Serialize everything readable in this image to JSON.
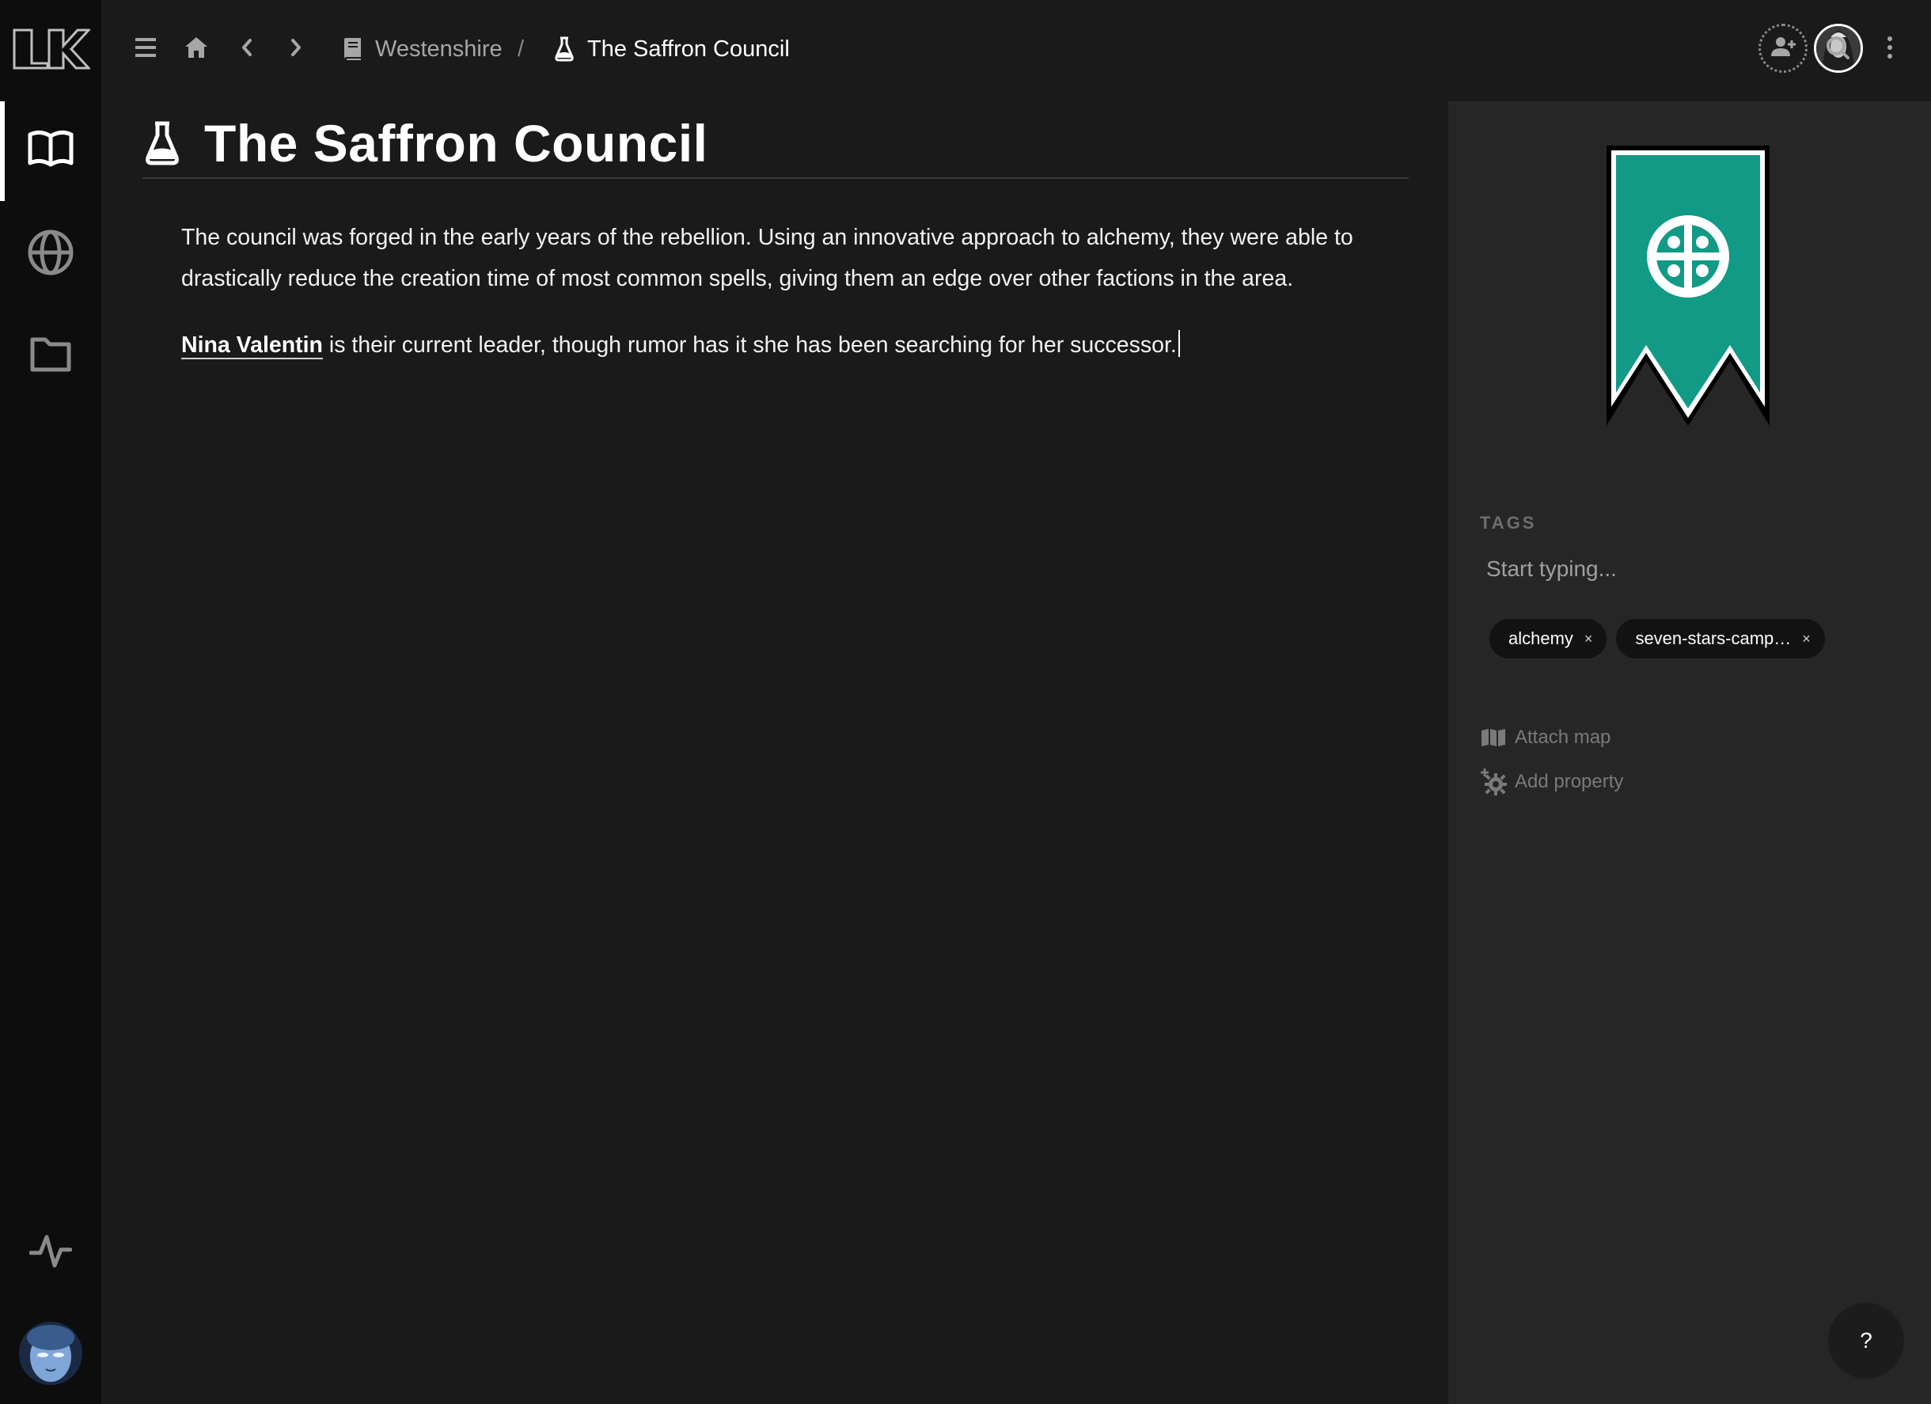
{
  "app": {
    "logo_text": "LK"
  },
  "rail": {
    "items": [
      {
        "icon": "open-book-icon",
        "active": true
      },
      {
        "icon": "globe-icon",
        "active": false
      },
      {
        "icon": "folder-icon",
        "active": false
      }
    ],
    "activity_icon": "activity-icon"
  },
  "breadcrumb": {
    "parent": "Westenshire",
    "separator": "/",
    "current": "The Saffron Council"
  },
  "document": {
    "title": "The Saffron Council",
    "paragraph1": "The council was forged in the early years of the rebellion. Using an innovative approach to alchemy, they were able to drastically reduce the creation time of most common spells, giving them an edge over other factions in the area.",
    "mention": "Nina Valentin",
    "paragraph2_rest": " is their current leader, though rumor has it she has been searching for her successor."
  },
  "sidebar": {
    "banner_color": "#119a85",
    "tags_label": "TAGS",
    "tag_input_placeholder": "Start typing...",
    "tags": [
      "alchemy",
      "seven-stars-camp…"
    ],
    "remove_glyph": "×",
    "attach_map": "Attach map",
    "add_property": "Add property"
  },
  "help_label": "?"
}
